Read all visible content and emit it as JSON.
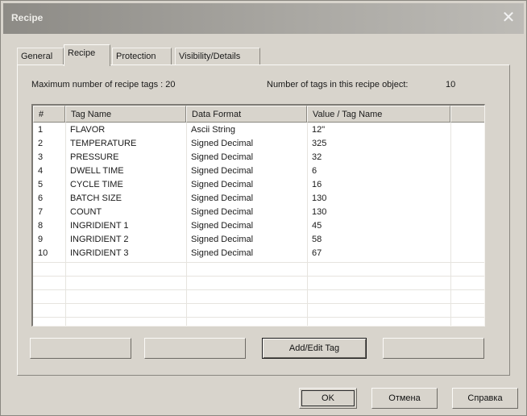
{
  "window": {
    "title": "Recipe",
    "close_glyph": "✕"
  },
  "tabs": [
    {
      "label": "General"
    },
    {
      "label": "Recipe"
    },
    {
      "label": "Protection"
    },
    {
      "label": "Visibility/Details"
    }
  ],
  "info": {
    "max_tags_label": "Maximum number of recipe tags : 20",
    "num_tags_label": "Number of tags in this recipe object:",
    "num_tags_value": "10"
  },
  "table": {
    "columns": [
      "#",
      "Tag Name",
      "Data Format",
      "Value / Tag Name"
    ],
    "rows": [
      [
        "1",
        "FLAVOR",
        "Ascii String",
        "12\""
      ],
      [
        "2",
        "TEMPERATURE",
        "Signed Decimal",
        "325"
      ],
      [
        "3",
        "PRESSURE",
        "Signed Decimal",
        "32"
      ],
      [
        "4",
        "DWELL TIME",
        "Signed Decimal",
        "6"
      ],
      [
        "5",
        "CYCLE TIME",
        "Signed Decimal",
        "16"
      ],
      [
        "6",
        "BATCH SIZE",
        "Signed Decimal",
        "130"
      ],
      [
        "7",
        "COUNT",
        "Signed Decimal",
        "130"
      ],
      [
        "8",
        "INGRIDIENT 1",
        "Signed Decimal",
        "45"
      ],
      [
        "9",
        "INGRIDIENT 2",
        "Signed Decimal",
        "58"
      ],
      [
        "10",
        "INGRIDIENT 3",
        "Signed Decimal",
        "67"
      ]
    ]
  },
  "actions": {
    "btn1": "",
    "btn2": "",
    "add_edit": "Add/Edit Tag",
    "btn4": ""
  },
  "footer": {
    "ok": "OK",
    "cancel": "Отмена",
    "help": "Справка"
  }
}
